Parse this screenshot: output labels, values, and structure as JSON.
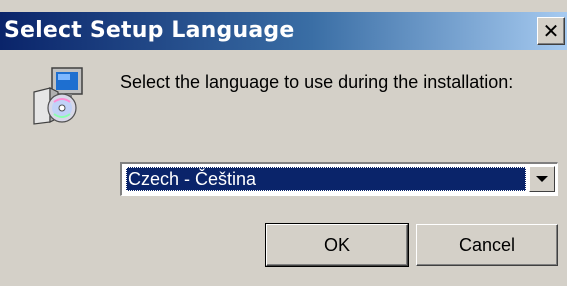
{
  "window": {
    "title": "Select Setup Language",
    "close_glyph": "✕"
  },
  "icon": {
    "name": "setup-installer-icon"
  },
  "prompt": "Select the language to use during the installation:",
  "language_select": {
    "selected": "Czech - Čeština"
  },
  "buttons": {
    "ok": "OK",
    "cancel": "Cancel"
  },
  "colors": {
    "titlebar_start": "#0a246a",
    "titlebar_end": "#a6caf0",
    "face": "#d4d0c8",
    "selection": "#0a246a"
  }
}
